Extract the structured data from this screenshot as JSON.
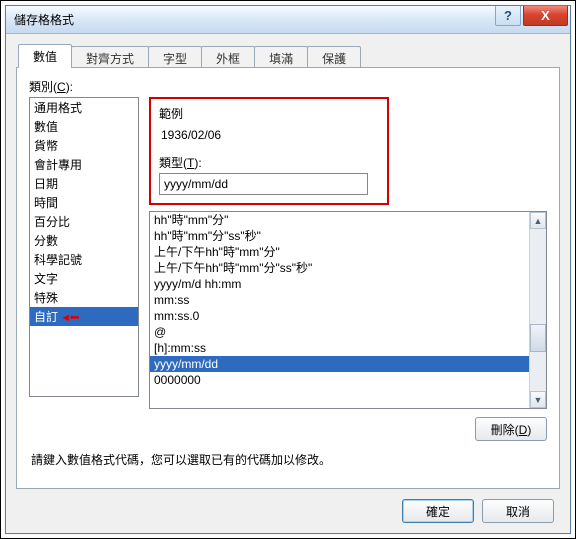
{
  "window": {
    "title": "儲存格格式",
    "help": "?",
    "close": "X"
  },
  "tabs": {
    "t0": "數值",
    "t1": "對齊方式",
    "t2": "字型",
    "t3": "外框",
    "t4": "填滿",
    "t5": "保護"
  },
  "labels": {
    "category": "類別",
    "category_key": "C",
    "sample": "範例",
    "type": "類型",
    "type_key": "T",
    "hint": "請鍵入數值格式代碼，您可以選取已有的代碼加以修改。"
  },
  "categories": [
    "通用格式",
    "數值",
    "貨幣",
    "會計專用",
    "日期",
    "時間",
    "百分比",
    "分數",
    "科學記號",
    "文字",
    "特殊",
    "自訂"
  ],
  "selected_category_index": 11,
  "category_arrow": "◄•••",
  "sample_value": "1936/02/06",
  "type_value": "yyyy/mm/dd",
  "formats": [
    "hh\"時\"mm\"分\"",
    "hh\"時\"mm\"分\"ss\"秒\"",
    "上午/下午hh\"時\"mm\"分\"",
    "上午/下午hh\"時\"mm\"分\"ss\"秒\"",
    "yyyy/m/d hh:mm",
    "mm:ss",
    "mm:ss.0",
    "@",
    "[h]:mm:ss",
    "yyyy/mm/dd",
    "0000000"
  ],
  "selected_format_index": 9,
  "buttons": {
    "delete": "刪除",
    "delete_key": "D",
    "ok": "確定",
    "cancel": "取消"
  },
  "scroll": {
    "up": "▲",
    "down": "▼"
  }
}
